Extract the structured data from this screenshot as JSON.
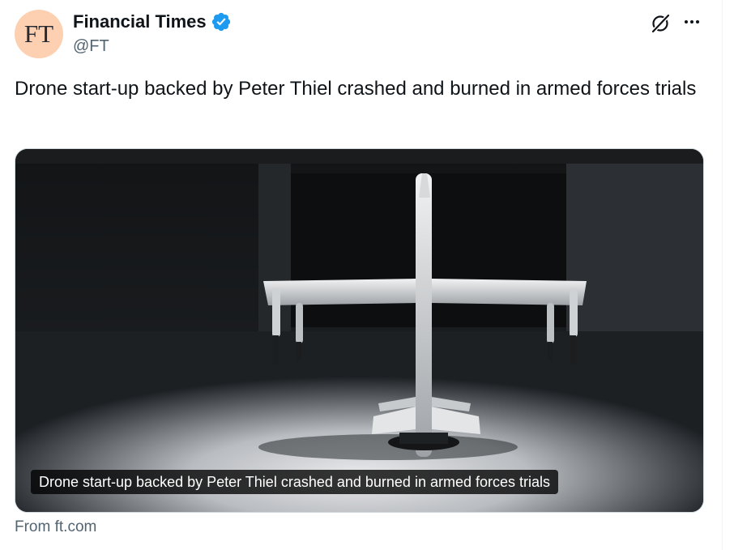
{
  "author": {
    "avatar_text": "FT",
    "display_name": "Financial Times",
    "handle": "@FT",
    "verified_icon": "verified-badge-icon"
  },
  "actions": {
    "grok_icon": "grok-icon",
    "more_icon": "more-horizontal-icon"
  },
  "tweet": {
    "text": "Drone start-up backed by Peter Thiel crashed and burned in armed forces trials"
  },
  "link_card": {
    "image_description_icon": "drone-photo",
    "caption": "Drone start-up backed by Peter Thiel crashed and burned in armed forces trials",
    "source": "From ft.com"
  },
  "colors": {
    "accent": "#1d9bf0",
    "avatar_bg": "#fcd0b1",
    "text_primary": "#0f1419",
    "text_secondary": "#536471"
  }
}
